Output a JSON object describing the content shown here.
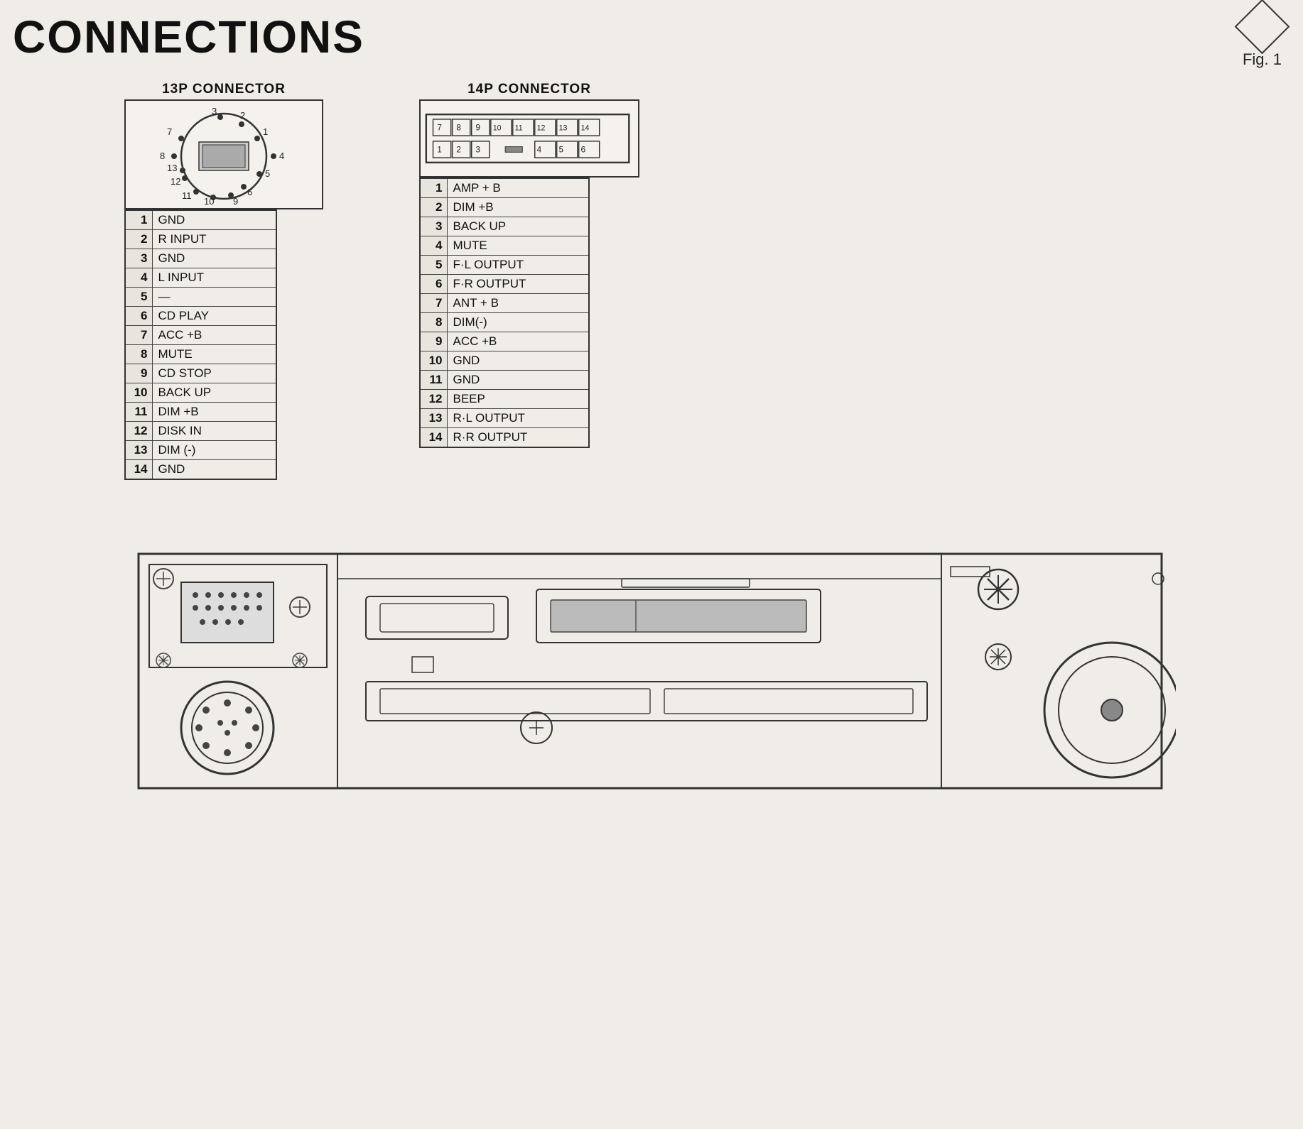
{
  "title": "CONNECTIONS",
  "fig": "Fig. 1",
  "connector13p": {
    "title": "13P CONNECTOR",
    "pins": [
      {
        "num": "1",
        "label": "GND"
      },
      {
        "num": "2",
        "label": "R INPUT"
      },
      {
        "num": "3",
        "label": "GND"
      },
      {
        "num": "4",
        "label": "L INPUT"
      },
      {
        "num": "5",
        "label": "—"
      },
      {
        "num": "6",
        "label": "CD PLAY"
      },
      {
        "num": "7",
        "label": "ACC +B"
      },
      {
        "num": "8",
        "label": "MUTE"
      },
      {
        "num": "9",
        "label": "CD STOP"
      },
      {
        "num": "10",
        "label": "BACK UP"
      },
      {
        "num": "11",
        "label": "DIM +B"
      },
      {
        "num": "12",
        "label": "DISK IN"
      },
      {
        "num": "13",
        "label": "DIM (-)"
      },
      {
        "num": "14",
        "label": "GND"
      }
    ]
  },
  "connector14p": {
    "title": "14P CONNECTOR",
    "pins": [
      {
        "num": "1",
        "label": "AMP  + B"
      },
      {
        "num": "2",
        "label": "DIM  +B"
      },
      {
        "num": "3",
        "label": "BACK UP"
      },
      {
        "num": "4",
        "label": "MUTE"
      },
      {
        "num": "5",
        "label": "F·L OUTPUT"
      },
      {
        "num": "6",
        "label": "F·R OUTPUT"
      },
      {
        "num": "7",
        "label": "ANT  + B"
      },
      {
        "num": "8",
        "label": "DIM(-)"
      },
      {
        "num": "9",
        "label": "ACC +B"
      },
      {
        "num": "10",
        "label": "GND"
      },
      {
        "num": "11",
        "label": "GND"
      },
      {
        "num": "12",
        "label": "BEEP"
      },
      {
        "num": "13",
        "label": "R·L OUTPUT"
      },
      {
        "num": "14",
        "label": "R·R OUTPUT"
      }
    ]
  }
}
